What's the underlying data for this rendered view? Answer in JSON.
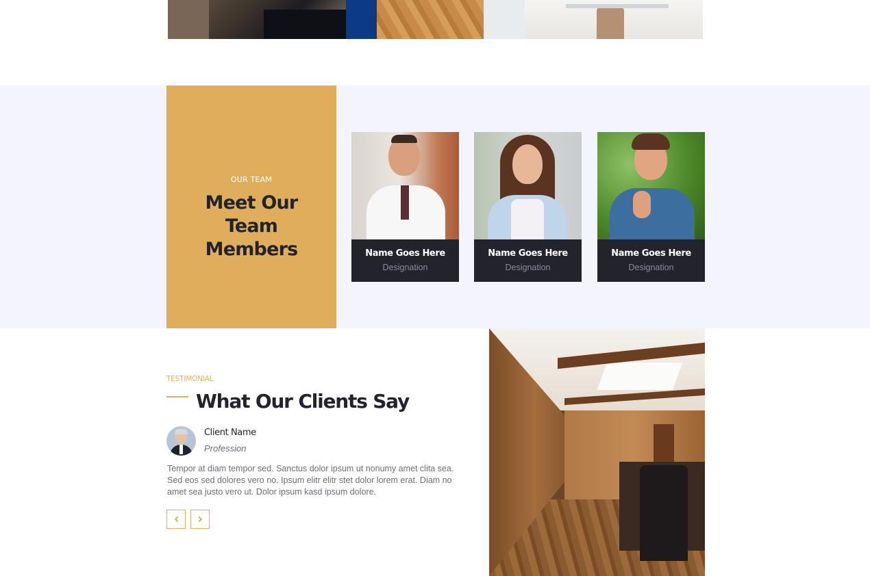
{
  "gallery": {
    "images": [
      "living-room",
      "dining-hall",
      "lounge-table"
    ]
  },
  "team": {
    "eyebrow": "OUR TEAM",
    "heading": "Meet Our Team Members",
    "members": [
      {
        "name": "Name Goes Here",
        "designation": "Designation"
      },
      {
        "name": "Name Goes Here",
        "designation": "Designation"
      },
      {
        "name": "Name Goes Here",
        "designation": "Designation"
      }
    ]
  },
  "testimonial": {
    "eyebrow": "TESTIMONIAL",
    "heading": "What Our Clients Say",
    "client_name": "Client Name",
    "profession": "Profession",
    "quote": "Tempor at diam tempor sed. Sanctus dolor ipsum ut nonumy amet clita sea. Sed eos sed dolores vero no. Ipsum elitr elitr stet dolor lorem erat. Diam no amet sea justo vero ut. Dolor ipsum kasd ipsum dolore.",
    "prev_icon": "chevron-left-icon",
    "next_icon": "chevron-right-icon"
  },
  "colors": {
    "accent": "#deae5d",
    "dark": "#23222d",
    "section_bg": "#f3f4fd",
    "text_muted": "#6c6d76"
  }
}
